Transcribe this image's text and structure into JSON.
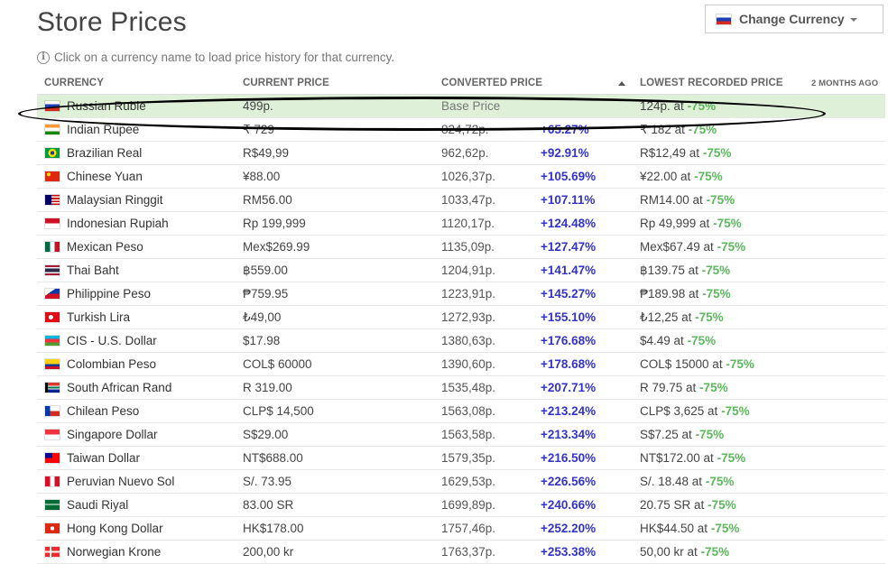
{
  "page": {
    "title": "Store Prices",
    "info_text": "Click on a currency name to load price history for that currency.",
    "change_currency_label": "Change Currency",
    "current_currency_flag": "ru"
  },
  "table": {
    "headers": {
      "currency": "CURRENCY",
      "current_price": "CURRENT PRICE",
      "converted_price": "CONVERTED PRICE",
      "lowest_price": "LOWEST RECORDED PRICE",
      "age": "2 MONTHS AGO"
    },
    "sort_column": "converted_price",
    "sort_direction": "ascending",
    "rows": [
      {
        "flag": "ru",
        "name": "Russian Ruble",
        "price": "499p.",
        "converted": "Base Price",
        "diff": "",
        "lowest": "124p. at",
        "discount": "-75%",
        "base": true
      },
      {
        "flag": "in",
        "name": "Indian Rupee",
        "price": "₹ 729",
        "converted": "824,72p.",
        "diff": "+65.27%",
        "lowest": "₹ 182 at",
        "discount": "-75%"
      },
      {
        "flag": "br",
        "name": "Brazilian Real",
        "price": "R$49,99",
        "converted": "962,62p.",
        "diff": "+92.91%",
        "lowest": "R$12,49 at",
        "discount": "-75%"
      },
      {
        "flag": "cn",
        "name": "Chinese Yuan",
        "price": "¥88.00",
        "converted": "1026,37p.",
        "diff": "+105.69%",
        "lowest": "¥22.00 at",
        "discount": "-75%"
      },
      {
        "flag": "my",
        "name": "Malaysian Ringgit",
        "price": "RM56.00",
        "converted": "1033,47p.",
        "diff": "+107.11%",
        "lowest": "RM14.00 at",
        "discount": "-75%"
      },
      {
        "flag": "id",
        "name": "Indonesian Rupiah",
        "price": "Rp 199,999",
        "converted": "1120,17p.",
        "diff": "+124.48%",
        "lowest": "Rp 49,999 at",
        "discount": "-75%"
      },
      {
        "flag": "mx",
        "name": "Mexican Peso",
        "price": "Mex$269.99",
        "converted": "1135,09p.",
        "diff": "+127.47%",
        "lowest": "Mex$67.49 at",
        "discount": "-75%"
      },
      {
        "flag": "th",
        "name": "Thai Baht",
        "price": "฿559.00",
        "converted": "1204,91p.",
        "diff": "+141.47%",
        "lowest": "฿139.75 at",
        "discount": "-75%"
      },
      {
        "flag": "ph",
        "name": "Philippine Peso",
        "price": "₱759.95",
        "converted": "1223,91p.",
        "diff": "+145.27%",
        "lowest": "₱189.98 at",
        "discount": "-75%"
      },
      {
        "flag": "tr",
        "name": "Turkish Lira",
        "price": "₺49,00",
        "converted": "1272,93p.",
        "diff": "+155.10%",
        "lowest": "₺12,25 at",
        "discount": "-75%"
      },
      {
        "flag": "az",
        "name": "CIS - U.S. Dollar",
        "price": "$17.98",
        "converted": "1380,63p.",
        "diff": "+176.68%",
        "lowest": "$4.49 at",
        "discount": "-75%"
      },
      {
        "flag": "co",
        "name": "Colombian Peso",
        "price": "COL$ 60000",
        "converted": "1390,60p.",
        "diff": "+178.68%",
        "lowest": "COL$ 15000 at",
        "discount": "-75%"
      },
      {
        "flag": "za",
        "name": "South African Rand",
        "price": "R 319.00",
        "converted": "1535,48p.",
        "diff": "+207.71%",
        "lowest": "R 79.75 at",
        "discount": "-75%"
      },
      {
        "flag": "cl",
        "name": "Chilean Peso",
        "price": "CLP$ 14,500",
        "converted": "1563,08p.",
        "diff": "+213.24%",
        "lowest": "CLP$ 3,625 at",
        "discount": "-75%"
      },
      {
        "flag": "sg",
        "name": "Singapore Dollar",
        "price": "S$29.00",
        "converted": "1563,58p.",
        "diff": "+213.34%",
        "lowest": "S$7.25 at",
        "discount": "-75%"
      },
      {
        "flag": "tw",
        "name": "Taiwan Dollar",
        "price": "NT$688.00",
        "converted": "1579,35p.",
        "diff": "+216.50%",
        "lowest": "NT$172.00 at",
        "discount": "-75%"
      },
      {
        "flag": "pe",
        "name": "Peruvian Nuevo Sol",
        "price": "S/. 73.95",
        "converted": "1629,53p.",
        "diff": "+226.56%",
        "lowest": "S/. 18.48 at",
        "discount": "-75%"
      },
      {
        "flag": "sa",
        "name": "Saudi Riyal",
        "price": "83.00 SR",
        "converted": "1699,89p.",
        "diff": "+240.66%",
        "lowest": "20.75 SR at",
        "discount": "-75%"
      },
      {
        "flag": "hk",
        "name": "Hong Kong Dollar",
        "price": "HK$178.00",
        "converted": "1757,46p.",
        "diff": "+252.20%",
        "lowest": "HK$44.50 at",
        "discount": "-75%"
      },
      {
        "flag": "no",
        "name": "Norwegian Krone",
        "price": "200,00 kr",
        "converted": "1763,37p.",
        "diff": "+253.38%",
        "lowest": "50,00 kr at",
        "discount": "-75%"
      }
    ]
  },
  "colors": {
    "base_row_bg": "#dff0d8",
    "percent_text": "#3333cc",
    "discount_text": "#5cb85c"
  }
}
